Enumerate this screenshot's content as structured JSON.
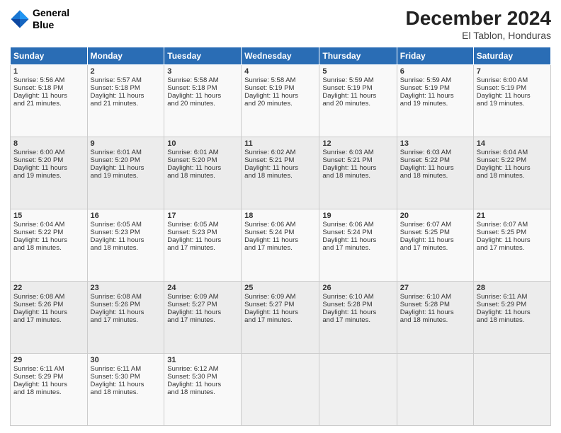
{
  "header": {
    "logo_line1": "General",
    "logo_line2": "Blue",
    "main_title": "December 2024",
    "subtitle": "El Tablon, Honduras"
  },
  "days_of_week": [
    "Sunday",
    "Monday",
    "Tuesday",
    "Wednesday",
    "Thursday",
    "Friday",
    "Saturday"
  ],
  "weeks": [
    [
      {
        "day": "1",
        "lines": [
          "Sunrise: 5:56 AM",
          "Sunset: 5:18 PM",
          "Daylight: 11 hours",
          "and 21 minutes."
        ]
      },
      {
        "day": "2",
        "lines": [
          "Sunrise: 5:57 AM",
          "Sunset: 5:18 PM",
          "Daylight: 11 hours",
          "and 21 minutes."
        ]
      },
      {
        "day": "3",
        "lines": [
          "Sunrise: 5:58 AM",
          "Sunset: 5:18 PM",
          "Daylight: 11 hours",
          "and 20 minutes."
        ]
      },
      {
        "day": "4",
        "lines": [
          "Sunrise: 5:58 AM",
          "Sunset: 5:19 PM",
          "Daylight: 11 hours",
          "and 20 minutes."
        ]
      },
      {
        "day": "5",
        "lines": [
          "Sunrise: 5:59 AM",
          "Sunset: 5:19 PM",
          "Daylight: 11 hours",
          "and 20 minutes."
        ]
      },
      {
        "day": "6",
        "lines": [
          "Sunrise: 5:59 AM",
          "Sunset: 5:19 PM",
          "Daylight: 11 hours",
          "and 19 minutes."
        ]
      },
      {
        "day": "7",
        "lines": [
          "Sunrise: 6:00 AM",
          "Sunset: 5:19 PM",
          "Daylight: 11 hours",
          "and 19 minutes."
        ]
      }
    ],
    [
      {
        "day": "8",
        "lines": [
          "Sunrise: 6:00 AM",
          "Sunset: 5:20 PM",
          "Daylight: 11 hours",
          "and 19 minutes."
        ]
      },
      {
        "day": "9",
        "lines": [
          "Sunrise: 6:01 AM",
          "Sunset: 5:20 PM",
          "Daylight: 11 hours",
          "and 19 minutes."
        ]
      },
      {
        "day": "10",
        "lines": [
          "Sunrise: 6:01 AM",
          "Sunset: 5:20 PM",
          "Daylight: 11 hours",
          "and 18 minutes."
        ]
      },
      {
        "day": "11",
        "lines": [
          "Sunrise: 6:02 AM",
          "Sunset: 5:21 PM",
          "Daylight: 11 hours",
          "and 18 minutes."
        ]
      },
      {
        "day": "12",
        "lines": [
          "Sunrise: 6:03 AM",
          "Sunset: 5:21 PM",
          "Daylight: 11 hours",
          "and 18 minutes."
        ]
      },
      {
        "day": "13",
        "lines": [
          "Sunrise: 6:03 AM",
          "Sunset: 5:22 PM",
          "Daylight: 11 hours",
          "and 18 minutes."
        ]
      },
      {
        "day": "14",
        "lines": [
          "Sunrise: 6:04 AM",
          "Sunset: 5:22 PM",
          "Daylight: 11 hours",
          "and 18 minutes."
        ]
      }
    ],
    [
      {
        "day": "15",
        "lines": [
          "Sunrise: 6:04 AM",
          "Sunset: 5:22 PM",
          "Daylight: 11 hours",
          "and 18 minutes."
        ]
      },
      {
        "day": "16",
        "lines": [
          "Sunrise: 6:05 AM",
          "Sunset: 5:23 PM",
          "Daylight: 11 hours",
          "and 18 minutes."
        ]
      },
      {
        "day": "17",
        "lines": [
          "Sunrise: 6:05 AM",
          "Sunset: 5:23 PM",
          "Daylight: 11 hours",
          "and 17 minutes."
        ]
      },
      {
        "day": "18",
        "lines": [
          "Sunrise: 6:06 AM",
          "Sunset: 5:24 PM",
          "Daylight: 11 hours",
          "and 17 minutes."
        ]
      },
      {
        "day": "19",
        "lines": [
          "Sunrise: 6:06 AM",
          "Sunset: 5:24 PM",
          "Daylight: 11 hours",
          "and 17 minutes."
        ]
      },
      {
        "day": "20",
        "lines": [
          "Sunrise: 6:07 AM",
          "Sunset: 5:25 PM",
          "Daylight: 11 hours",
          "and 17 minutes."
        ]
      },
      {
        "day": "21",
        "lines": [
          "Sunrise: 6:07 AM",
          "Sunset: 5:25 PM",
          "Daylight: 11 hours",
          "and 17 minutes."
        ]
      }
    ],
    [
      {
        "day": "22",
        "lines": [
          "Sunrise: 6:08 AM",
          "Sunset: 5:26 PM",
          "Daylight: 11 hours",
          "and 17 minutes."
        ]
      },
      {
        "day": "23",
        "lines": [
          "Sunrise: 6:08 AM",
          "Sunset: 5:26 PM",
          "Daylight: 11 hours",
          "and 17 minutes."
        ]
      },
      {
        "day": "24",
        "lines": [
          "Sunrise: 6:09 AM",
          "Sunset: 5:27 PM",
          "Daylight: 11 hours",
          "and 17 minutes."
        ]
      },
      {
        "day": "25",
        "lines": [
          "Sunrise: 6:09 AM",
          "Sunset: 5:27 PM",
          "Daylight: 11 hours",
          "and 17 minutes."
        ]
      },
      {
        "day": "26",
        "lines": [
          "Sunrise: 6:10 AM",
          "Sunset: 5:28 PM",
          "Daylight: 11 hours",
          "and 17 minutes."
        ]
      },
      {
        "day": "27",
        "lines": [
          "Sunrise: 6:10 AM",
          "Sunset: 5:28 PM",
          "Daylight: 11 hours",
          "and 18 minutes."
        ]
      },
      {
        "day": "28",
        "lines": [
          "Sunrise: 6:11 AM",
          "Sunset: 5:29 PM",
          "Daylight: 11 hours",
          "and 18 minutes."
        ]
      }
    ],
    [
      {
        "day": "29",
        "lines": [
          "Sunrise: 6:11 AM",
          "Sunset: 5:29 PM",
          "Daylight: 11 hours",
          "and 18 minutes."
        ]
      },
      {
        "day": "30",
        "lines": [
          "Sunrise: 6:11 AM",
          "Sunset: 5:30 PM",
          "Daylight: 11 hours",
          "and 18 minutes."
        ]
      },
      {
        "day": "31",
        "lines": [
          "Sunrise: 6:12 AM",
          "Sunset: 5:30 PM",
          "Daylight: 11 hours",
          "and 18 minutes."
        ]
      },
      null,
      null,
      null,
      null
    ]
  ]
}
